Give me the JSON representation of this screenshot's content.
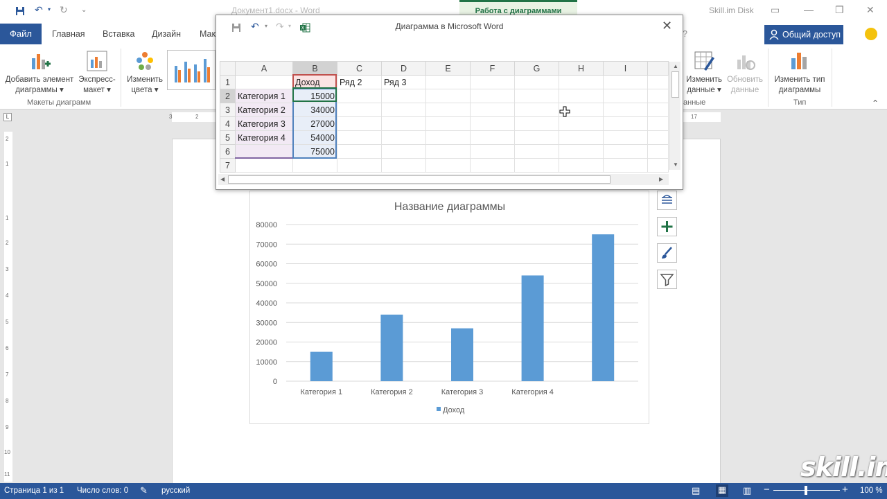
{
  "titlebar": {
    "document_title": "Документ1.docx - Word",
    "context_tab_group": "Работа с диаграммами",
    "account": "Skill.im Disk"
  },
  "ribbon_tabs": {
    "file": "Файл",
    "tabs": [
      "Главная",
      "Вставка",
      "Дизайн",
      "Мак"
    ],
    "share": "Общий доступ"
  },
  "ribbon": {
    "add_element": [
      "Добавить элемент",
      "диаграммы ▾"
    ],
    "quick_layout": [
      "Экспресс-",
      "макет ▾"
    ],
    "change_colors": [
      "Изменить",
      "цвета ▾"
    ],
    "group_layouts": "Макеты диаграмм",
    "edit_data": [
      "Изменить",
      "данные ▾"
    ],
    "refresh_data": [
      "Обновить",
      "данные"
    ],
    "group_data_partial": "анные",
    "change_type": [
      "Изменить тип",
      "диаграммы"
    ],
    "group_type": "Тип"
  },
  "ruler": {
    "left_numbers": [
      "3",
      "2"
    ],
    "right_numbers": [
      "17"
    ],
    "vertical_numbers": [
      "2",
      "1",
      "1",
      "2",
      "3",
      "4",
      "5",
      "6",
      "7",
      "8",
      "9",
      "10",
      "11"
    ]
  },
  "excel": {
    "title": "Диаграмма в Microsoft Word",
    "columns": [
      "A",
      "B",
      "C",
      "D",
      "E",
      "F",
      "G",
      "H",
      "I"
    ],
    "rows": [
      {
        "n": "1",
        "A": "",
        "B": "Доход",
        "C": "Ряд 2",
        "D": "Ряд 3"
      },
      {
        "n": "2",
        "A": "Категория 1",
        "B": "15000",
        "C": "",
        "D": ""
      },
      {
        "n": "3",
        "A": "Категория 2",
        "B": "34000",
        "C": "",
        "D": ""
      },
      {
        "n": "4",
        "A": "Категория 3",
        "B": "27000",
        "C": "",
        "D": ""
      },
      {
        "n": "5",
        "A": "Категория 4",
        "B": "54000",
        "C": "",
        "D": ""
      },
      {
        "n": "6",
        "A": "",
        "B": "75000",
        "C": "",
        "D": ""
      },
      {
        "n": "7",
        "A": "",
        "B": "",
        "C": "",
        "D": ""
      }
    ]
  },
  "chart_data": {
    "type": "bar",
    "title": "Название диаграммы",
    "categories": [
      "Категория 1",
      "Категория 2",
      "Категория 3",
      "Категория 4",
      ""
    ],
    "series": [
      {
        "name": "Доход",
        "values": [
          15000,
          34000,
          27000,
          54000,
          75000
        ],
        "color": "#5b9bd5"
      }
    ],
    "yticks": [
      "0",
      "10000",
      "20000",
      "30000",
      "40000",
      "50000",
      "60000",
      "70000",
      "80000"
    ],
    "ylim": [
      0,
      80000
    ],
    "grid": true,
    "legend": "bottom"
  },
  "statusbar": {
    "page": "Страница 1 из 1",
    "words": "Число слов: 0",
    "language": "русский",
    "zoom": "100 %"
  },
  "watermark": "skill.im",
  "colors": {
    "word_blue": "#2b579a",
    "excel_green": "#217346",
    "bar": "#5b9bd5"
  }
}
